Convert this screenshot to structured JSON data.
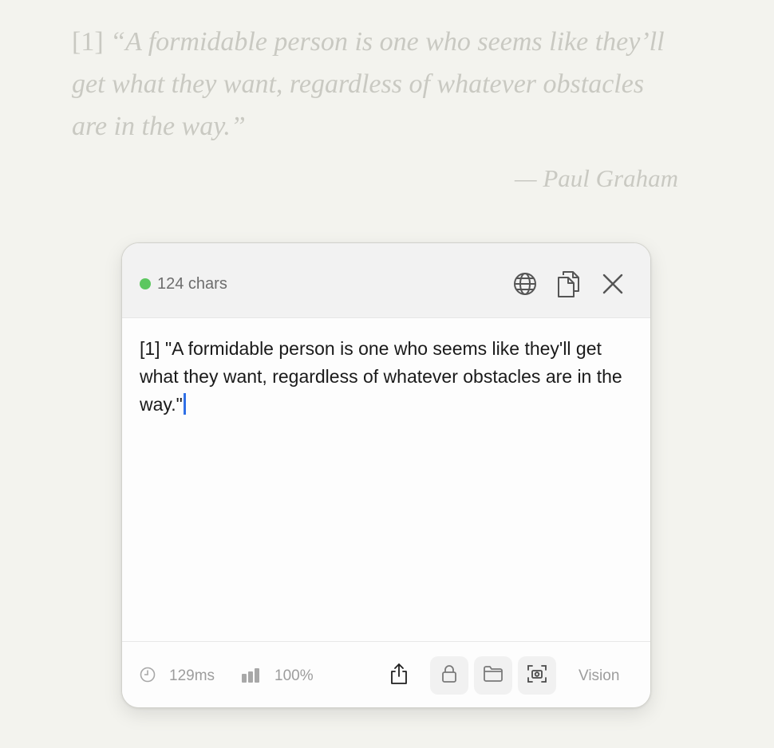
{
  "background": {
    "quote_ref": "[1] ",
    "quote_text": "“A formidable person is one who seems like they’ll get what they want, regardless of whatever obstacles are in the way.”",
    "attribution": "— Paul Graham"
  },
  "panel": {
    "status_color": "#5cc75f",
    "char_count": "124 chars",
    "header_icons": [
      "globe-icon",
      "copy-icon",
      "close-icon"
    ],
    "text_content": "[1] \"A formidable person is one who seems like they'll get what they want, regardless of whatever obstacles are in the way.\"",
    "caret_color": "#2f6fe6",
    "footer": {
      "time": "129ms",
      "confidence": "100%",
      "tool_icons": [
        "share-icon",
        "lock-icon",
        "folder-icon",
        "screenshot-icon"
      ],
      "vision_label": "Vision"
    }
  }
}
